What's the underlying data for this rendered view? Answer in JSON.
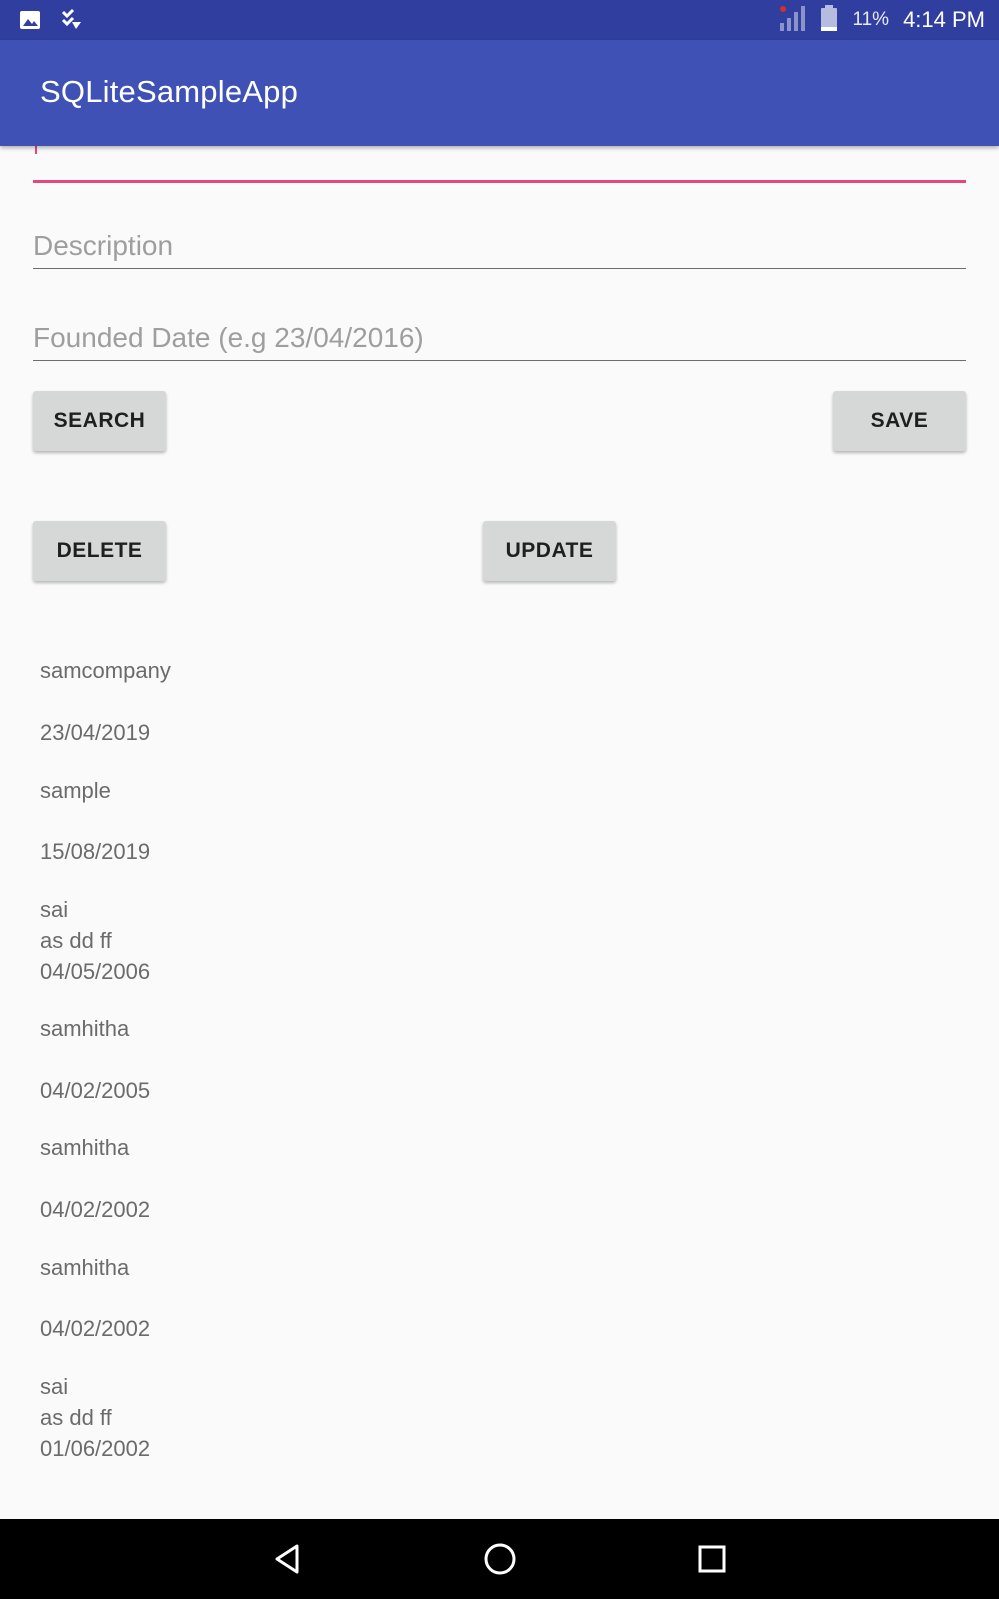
{
  "status_bar": {
    "icons_left": [
      "gallery-icon",
      "checklist-icon"
    ],
    "battery_percent": "11%",
    "time": "4:14 PM"
  },
  "app_bar": {
    "title": "SQLiteSampleApp"
  },
  "form": {
    "name_field": {
      "value": "",
      "placeholder": ""
    },
    "description_field": {
      "value": "",
      "placeholder": "Description"
    },
    "date_field": {
      "value": "",
      "placeholder": "Founded Date (e.g 23/04/2016)"
    },
    "accent_color": "#e8457f"
  },
  "buttons": {
    "search": "SEARCH",
    "save": "SAVE",
    "delete": "DELETE",
    "update": "UPDATE"
  },
  "records": [
    "samcompany",
    "23/04/2019",
    "sample",
    "15/08/2019",
    "sai",
    "as dd ff",
    "04/05/2006",
    "samhitha",
    "04/02/2005",
    "samhitha",
    "04/02/2002",
    "samhitha",
    "04/02/2002",
    "sai",
    "as dd ff",
    "01/06/2002"
  ],
  "colors": {
    "status_bar": "#303f9f",
    "app_bar": "#3f51b5",
    "button": "#d6d7d7",
    "background": "#fafafa"
  }
}
